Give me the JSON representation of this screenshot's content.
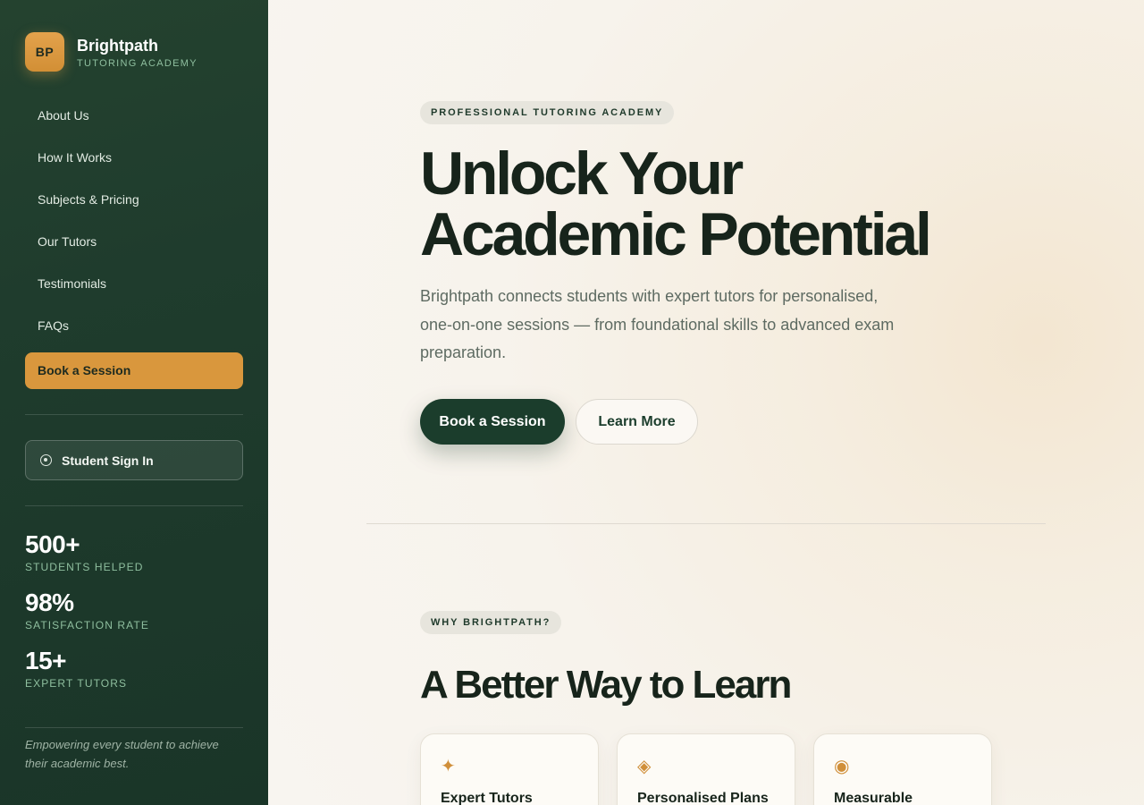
{
  "brand": {
    "logo_initials": "BP",
    "name": "Brightpath",
    "subtitle": "TUTORING ACADEMY"
  },
  "sidebar": {
    "nav_items": [
      {
        "label": "About Us"
      },
      {
        "label": "How It Works"
      },
      {
        "label": "Subjects & Pricing"
      },
      {
        "label": "Our Tutors"
      },
      {
        "label": "Testimonials"
      },
      {
        "label": "FAQs"
      }
    ],
    "cta_label": "Book a Session",
    "signin_label": "Student Sign In",
    "signin_icon": "user-circle-icon",
    "stats": [
      {
        "value": "500+",
        "label": "STUDENTS HELPED"
      },
      {
        "value": "98%",
        "label": "SATISFACTION RATE"
      },
      {
        "value": "15+",
        "label": "EXPERT TUTORS"
      }
    ],
    "tagline": "Empowering every student to achieve their academic best."
  },
  "hero": {
    "eyebrow": "PROFESSIONAL TUTORING ACADEMY",
    "title_line1": "Unlock Your",
    "title_line2": "Academic Potential",
    "description": "Brightpath connects students with expert tutors for personalised, one-on-one sessions — from foundational skills to advanced exam preparation.",
    "primary_button": "Book a Session",
    "secondary_button": "Learn More"
  },
  "features": {
    "eyebrow": "WHY BRIGHTPATH?",
    "title": "A Better Way to Learn",
    "cards": [
      {
        "icon": "✦",
        "icon_name": "sparkle-icon",
        "title": "Expert Tutors"
      },
      {
        "icon": "◈",
        "icon_name": "diamond-icon",
        "title": "Personalised Plans"
      },
      {
        "icon": "◉",
        "icon_name": "target-icon",
        "title": "Measurable"
      }
    ]
  },
  "colors": {
    "sidebar_bg": "#1f3c2d",
    "accent": "#d9973d",
    "primary_dark": "#1b3d2c",
    "page_bg": "#f7f2ea"
  }
}
